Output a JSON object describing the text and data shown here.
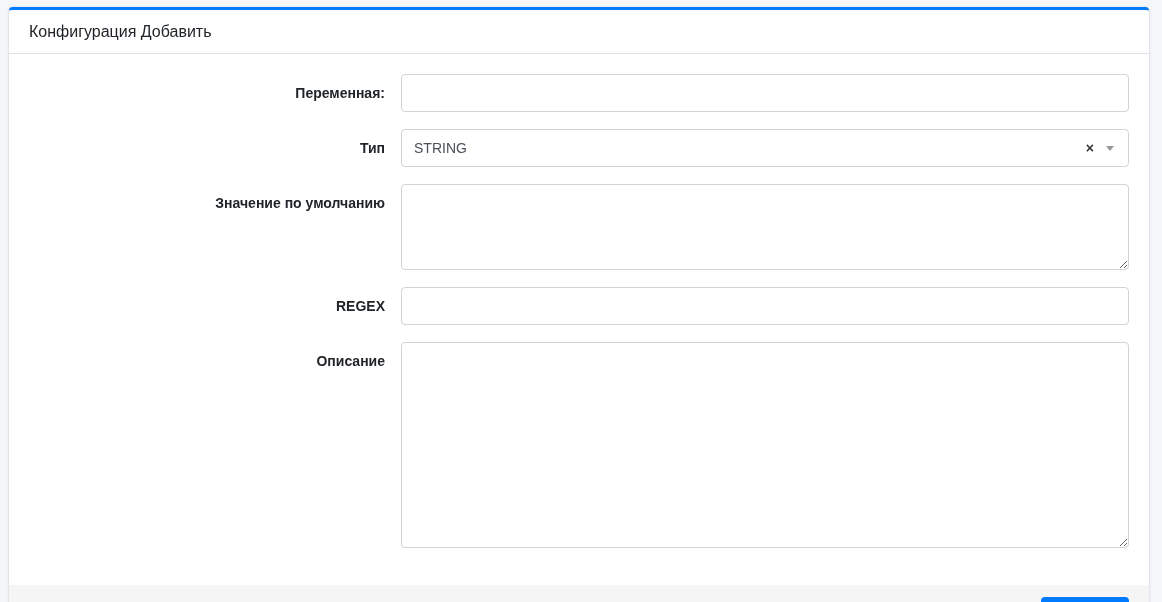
{
  "card": {
    "title": "Конфигурация Добавить"
  },
  "fields": [
    {
      "label": "Переменная:",
      "kind": "input"
    },
    {
      "label": "Тип",
      "kind": "select",
      "value": "STRING",
      "clear": "×"
    },
    {
      "label": "Значение по умолчанию",
      "kind": "textarea"
    },
    {
      "label": "REGEX",
      "kind": "input"
    },
    {
      "label": "Описание",
      "kind": "longtext"
    }
  ]
}
